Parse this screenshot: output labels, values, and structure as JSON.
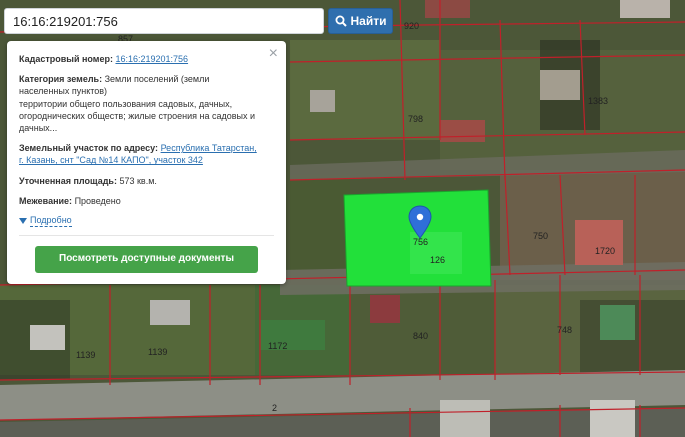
{
  "search": {
    "value": "16:16:219201:756",
    "button_label": "Найти"
  },
  "popup": {
    "cadastral_label": "Кадастровый номер:",
    "cadastral_value": "16:16:219201:756",
    "category_label": "Категория земель:",
    "category_value_1": "Земли поселений (земли",
    "category_value_2": "населенных пунктов)",
    "category_value_3": "территории общего пользования садовых, дачных,",
    "category_value_4": "огороднических обществ; жилые строения на садовых и",
    "category_value_5": "дачных...",
    "address_label": "Земельный участок по адресу:",
    "address_value_1": "Республика Татарстан,",
    "address_value_2": "г. Казань, снт \"Сад №14 КАПО\", участок 342",
    "area_label": "Уточненная площадь:",
    "area_value": "573 кв.м.",
    "survey_label": "Межевание:",
    "survey_value": "Проведено",
    "more_label": "Подробно",
    "docs_button": "Посмотреть доступные документы",
    "close_glyph": "×"
  },
  "map": {
    "lot_labels": [
      "857",
      "920",
      "798",
      "1383",
      "750",
      "1720",
      "840",
      "748",
      "1172",
      "1139",
      "1139",
      "2",
      "756",
      "126"
    ],
    "highlight_color": "#22e03a",
    "boundary_color": "#c0202a",
    "marker_color": "#2f6fd8"
  }
}
